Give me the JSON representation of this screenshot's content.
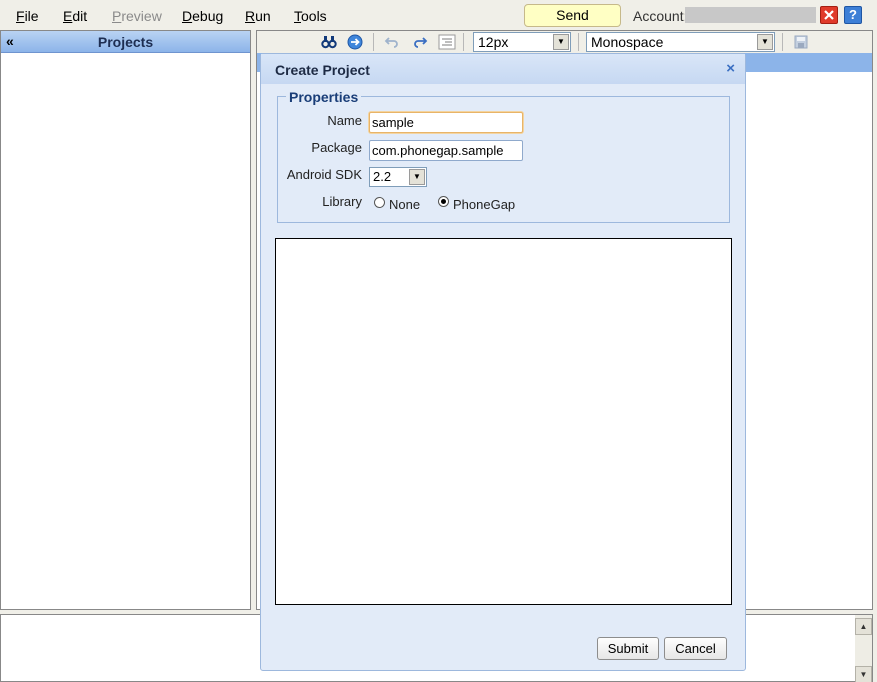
{
  "menu": {
    "items": [
      {
        "label_u": "F",
        "label_rest": "ile",
        "disabled": false
      },
      {
        "label_u": "E",
        "label_rest": "dit",
        "disabled": false
      },
      {
        "label_u": "P",
        "label_rest": "review",
        "disabled": true
      },
      {
        "label_u": "D",
        "label_rest": "ebug",
        "disabled": false
      },
      {
        "label_u": "R",
        "label_rest": "un",
        "disabled": false
      },
      {
        "label_u": "T",
        "label_rest": "ools",
        "disabled": false
      }
    ],
    "feedback_label": "Send Feedback",
    "account_label": "Account:",
    "help_label": "?"
  },
  "projects": {
    "collapse_icon": "«",
    "title": "Projects"
  },
  "editor_toolbar": {
    "font_size": "12px",
    "font_family": "Monospace",
    "icons": [
      "find-icon",
      "goto-icon",
      "undo-icon",
      "redo-icon",
      "indent-icon",
      "save-icon"
    ]
  },
  "dialog": {
    "title": "Create Project",
    "close_label": "×",
    "legend": "Properties",
    "name_label": "Name",
    "name_value": "sample",
    "package_label": "Package",
    "package_value": "com.phonegap.sample",
    "sdk_label": "Android SDK",
    "sdk_value": "2.2",
    "library_label": "Library",
    "library_options": [
      "None",
      "PhoneGap"
    ],
    "library_selected": "PhoneGap",
    "submit_label": "Submit",
    "cancel_label": "Cancel"
  },
  "colors": {
    "header_blue": "#8cb4e9",
    "dialog_bg": "#e2ebf8",
    "feedback_bg": "#ffffc4"
  }
}
